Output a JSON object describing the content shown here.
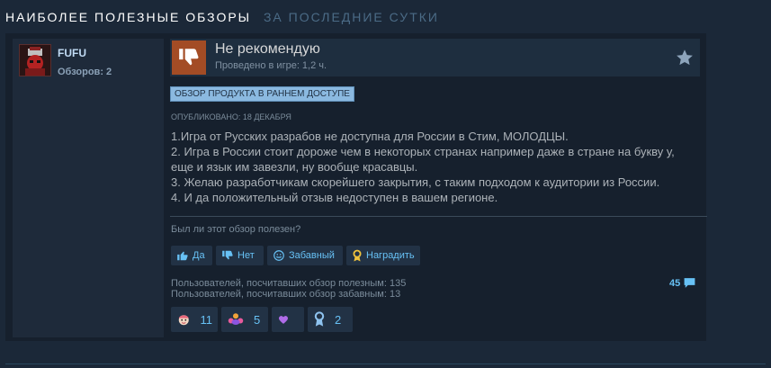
{
  "header": {
    "title": "Наиболее полезные обзоры",
    "period": "за последние сутки"
  },
  "author": {
    "name": "FUFU",
    "reviews": "Обзоров: 2"
  },
  "review": {
    "recommendation": "Не рекомендую",
    "hours": "Проведено в игре: 1,2 ч.",
    "early_access_badge": "Обзор продукта в раннем доступе",
    "posted": "Опубликовано: 18 декабря",
    "lines": [
      "1.Игра от Русских разрабов не доступна для России в Стим, МОЛОДЦЫ.",
      "2. Игра в России стоит дороже чем в некоторых странах например даже в стране на букву у,",
      "еще и язык им завезли, ну вообще красавцы.",
      "3. Желаю разработчикам скорейшего закрытия, с таким подходом к аудитории из России.",
      "4. И да положительный отзыв недоступен в вашем регионе."
    ]
  },
  "feedback": {
    "question": "Был ли этот обзор полезен?",
    "yes": "Да",
    "no": "Нет",
    "funny": "Забавный",
    "award": "Наградить"
  },
  "stats": {
    "helpful": "Пользователей, посчитавших обзор полезным: 135",
    "funny": "Пользователей, посчитавших обзор забавным: 13",
    "comments": "45"
  },
  "awards": [
    {
      "icon": "face-award-icon",
      "count": "11"
    },
    {
      "icon": "flower-award-icon",
      "count": "5"
    },
    {
      "icon": "heart-award-icon",
      "count": ""
    },
    {
      "icon": "medal-award-icon",
      "count": "2"
    }
  ],
  "colors": {
    "background": "#1b2838",
    "accent": "#67c1f5",
    "thumb_down": "#a34c25"
  }
}
